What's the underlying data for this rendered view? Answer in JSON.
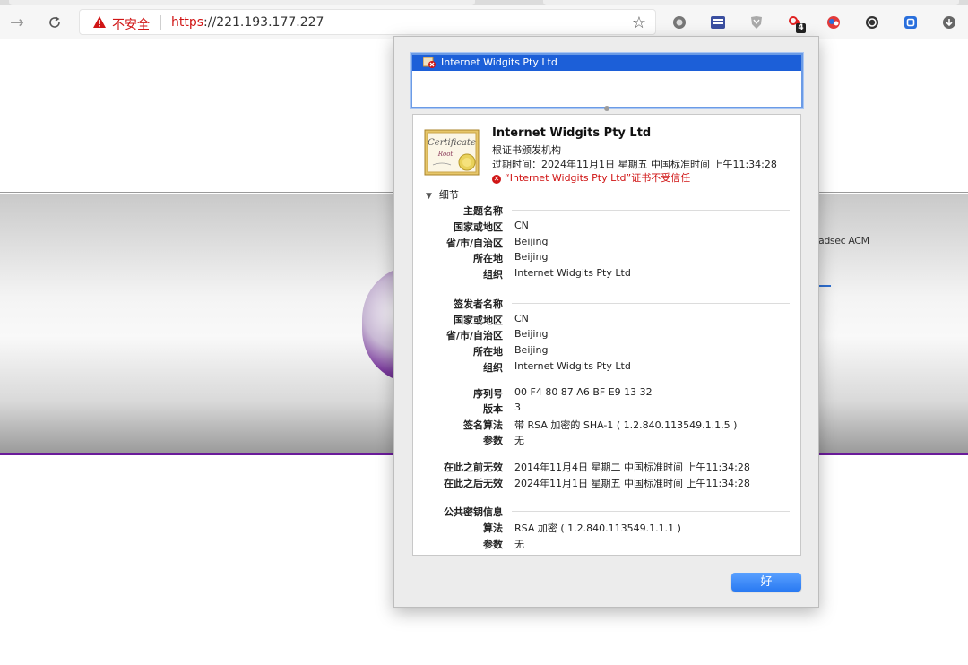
{
  "browser": {
    "security_label": "不安全",
    "url_scheme": "https",
    "url_rest": "://221.193.177.227",
    "extension_badge": "4"
  },
  "page": {
    "banner_text": "adsec ACM"
  },
  "dialog": {
    "chain_item": "Internet Widgits Pty Ltd",
    "cert_image_text_1": "Certificate",
    "cert_image_text_2": "Root",
    "title": "Internet Widgits Pty Ltd",
    "subtitle": "根证书颁发机构",
    "expiry": "过期时间：2024年11月1日 星期五 中国标准时间 上午11:34:28",
    "error": "“Internet Widgits Pty Ltd”证书不受信任",
    "disclosure_label": "细节",
    "subject": {
      "heading": "主题名称",
      "rows": [
        {
          "label": "国家或地区",
          "value": "CN"
        },
        {
          "label": "省/市/自治区",
          "value": "Beijing"
        },
        {
          "label": "所在地",
          "value": "Beijing"
        },
        {
          "label": "组织",
          "value": "Internet Widgits Pty Ltd"
        }
      ]
    },
    "issuer": {
      "heading": "签发者名称",
      "rows": [
        {
          "label": "国家或地区",
          "value": "CN"
        },
        {
          "label": "省/市/自治区",
          "value": "Beijing"
        },
        {
          "label": "所在地",
          "value": "Beijing"
        },
        {
          "label": "组织",
          "value": "Internet Widgits Pty Ltd"
        }
      ]
    },
    "cert_info": [
      {
        "label": "序列号",
        "value": "00 F4 80 87 A6 BF E9 13 32"
      },
      {
        "label": "版本",
        "value": "3"
      },
      {
        "label": "签名算法",
        "value": "带 RSA 加密的 SHA-1 ( 1.2.840.113549.1.1.5 )"
      },
      {
        "label": "参数",
        "value": "无"
      }
    ],
    "validity": [
      {
        "label": "在此之前无效",
        "value": "2014年11月4日 星期二 中国标准时间 上午11:34:28"
      },
      {
        "label": "在此之后无效",
        "value": "2024年11月1日 星期五 中国标准时间 上午11:34:28"
      }
    ],
    "public_key": {
      "heading": "公共密钥信息",
      "rows": [
        {
          "label": "算法",
          "value": "RSA 加密 ( 1.2.840.113549.1.1.1 )"
        },
        {
          "label": "参数",
          "value": "无"
        }
      ]
    },
    "ok_label": "好"
  },
  "colors": {
    "accent": "#1c5fd8",
    "error": "#d01515",
    "banner_bottom": "#6a1b9a"
  },
  "icons": [
    "back-arrow-icon",
    "reload-icon",
    "warning-icon",
    "star-icon",
    "certificate-icon"
  ]
}
